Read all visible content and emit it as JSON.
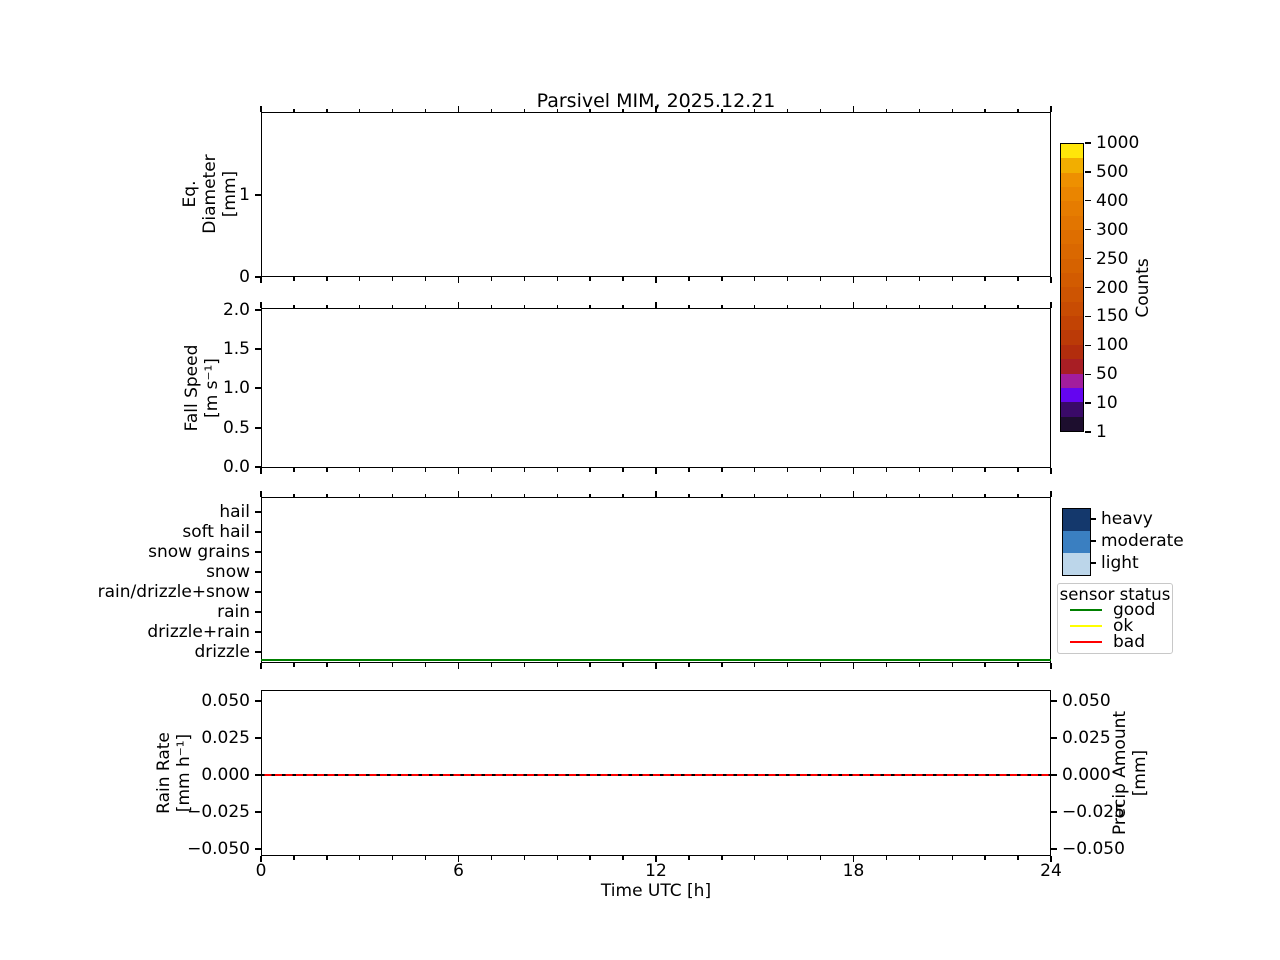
{
  "title": "Parsivel MIM, 2025.12.21",
  "chart_data": {
    "type": "multi-panel-timeseries",
    "title": "Parsivel MIM, 2025.12.21",
    "x_axis": {
      "label": "Time UTC [h]",
      "range_h": [
        0,
        24
      ],
      "major_ticks": [
        0,
        6,
        12,
        18,
        24
      ],
      "major_tick_labels": [
        "0",
        "6",
        "12",
        "18",
        "24"
      ],
      "minor_tick_interval_h": 1
    },
    "panels": [
      {
        "id": "eq-diameter",
        "ylabel": "Eq.\nDiameter\n[mm]",
        "ylim": [
          0,
          2
        ],
        "yticks": [
          1,
          0
        ],
        "ytick_labels": [
          "1",
          "0"
        ],
        "series": []
      },
      {
        "id": "fall-speed",
        "ylabel": "Fall Speed\n[m s⁻¹]",
        "ylim": [
          0.0,
          2.0
        ],
        "yticks": [
          2.0,
          1.5,
          1.0,
          0.5,
          0.0
        ],
        "ytick_labels": [
          "2.0",
          "1.5",
          "1.0",
          "0.5",
          "0.0"
        ],
        "series": []
      },
      {
        "id": "weather-code",
        "categories_top_to_bottom": [
          "hail",
          "soft hail",
          "snow grains",
          "snow",
          "rain/drizzle+snow",
          "rain",
          "drizzle+rain",
          "drizzle"
        ],
        "series": [
          {
            "name": "sensor status",
            "value": "good",
            "color": "#008000",
            "style": "solid",
            "x_range_h": [
              0,
              24
            ],
            "position": "constant line at panel bottom, below drizzle"
          }
        ]
      },
      {
        "id": "rain-rate",
        "ylabel": "Rain Rate\n[mm h⁻¹]",
        "ylabel_right": "Precip Amount\n[mm]",
        "ylim": [
          -0.055,
          0.055
        ],
        "yticks": [
          0.05,
          0.025,
          0.0,
          -0.025,
          -0.05
        ],
        "ytick_labels": [
          "0.050",
          "0.025",
          "0.000",
          "−0.025",
          "−0.050"
        ],
        "series": [
          {
            "name": "Rain Rate",
            "color": "#ff0000",
            "style": "solid",
            "constant_value": 0.0,
            "x_range_h": [
              0,
              24
            ]
          },
          {
            "name": "Precip Amount",
            "color": "#000000",
            "style": "dashed",
            "constant_value": 0.0,
            "x_range_h": [
              0,
              24
            ]
          }
        ]
      }
    ],
    "colorbar": {
      "label": "Counts",
      "tick_labels_top_to_bottom": [
        "1000",
        "500",
        "400",
        "300",
        "250",
        "200",
        "150",
        "100",
        "50",
        "10",
        "1"
      ],
      "tick_values": [
        1,
        10,
        50,
        100,
        150,
        200,
        250,
        300,
        400,
        500,
        1000
      ],
      "segments_per_tick_interval": 2,
      "segment_colors_bottom_to_top": [
        "#1d0e2e",
        "#3a0a68",
        "#6405f0",
        "#a21d9d",
        "#a81e24",
        "#b22d0d",
        "#bb3a07",
        "#c24304",
        "#c84c03",
        "#cd5402",
        "#d25b01",
        "#d66200",
        "#da6800",
        "#de6e00",
        "#e27500",
        "#e67c00",
        "#ea8500",
        "#ee9000",
        "#f2ae00",
        "#ffe60a"
      ]
    },
    "intensity_legend": {
      "items_top_to_bottom": [
        {
          "label": "heavy",
          "color": "#14386c"
        },
        {
          "label": "moderate",
          "color": "#3a7fc1"
        },
        {
          "label": "light",
          "color": "#bcd6ea"
        }
      ]
    },
    "status_legend": {
      "title": "sensor status",
      "items": [
        {
          "label": "good",
          "color": "#008000"
        },
        {
          "label": "ok",
          "color": "#ffff00"
        },
        {
          "label": "bad",
          "color": "#ff0000"
        }
      ]
    }
  }
}
